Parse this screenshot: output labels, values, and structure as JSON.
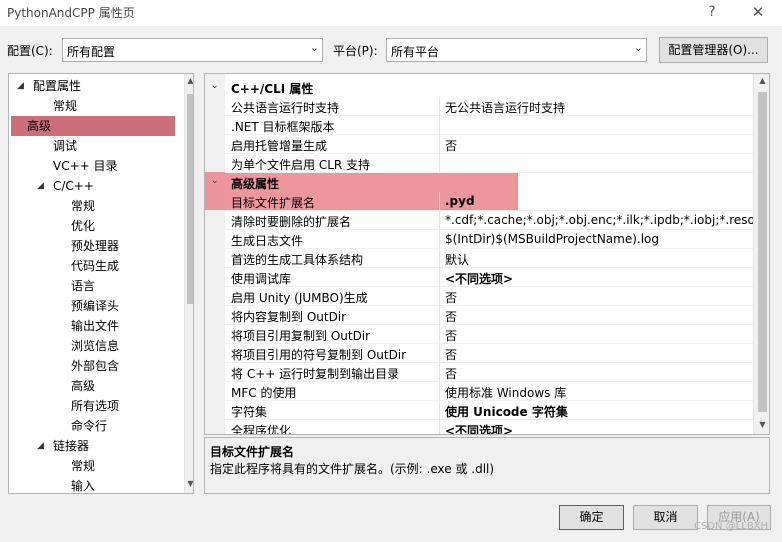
{
  "window": {
    "title": "PythonAndCPP 属性页",
    "help": "?",
    "close": "✕"
  },
  "config": {
    "label": "配置(C):",
    "value": "所有配置"
  },
  "platform": {
    "label": "平台(P):",
    "value": "所有平台"
  },
  "manager_button": "配置管理器(O)...",
  "tree": {
    "items": [
      {
        "label": "配置属性",
        "expander": "◢"
      },
      {
        "label": "常规"
      },
      {
        "label": "高级"
      },
      {
        "label": "调试"
      },
      {
        "label": "VC++ 目录"
      },
      {
        "label": "C/C++",
        "expander": "◢"
      },
      {
        "label": "常规"
      },
      {
        "label": "优化"
      },
      {
        "label": "预处理器"
      },
      {
        "label": "代码生成"
      },
      {
        "label": "语言"
      },
      {
        "label": "预编译头"
      },
      {
        "label": "输出文件"
      },
      {
        "label": "浏览信息"
      },
      {
        "label": "外部包含"
      },
      {
        "label": "高级"
      },
      {
        "label": "所有选项"
      },
      {
        "label": "命令行"
      },
      {
        "label": "链接器",
        "expander": "◢"
      },
      {
        "label": "常规"
      },
      {
        "label": "输入"
      }
    ],
    "selected_index": 2
  },
  "grid": {
    "rows": [
      {
        "name": "C++/CLI 属性",
        "expander": "⌄"
      },
      {
        "name": "公共语言运行时支持",
        "value": "无公共语言运行时支持"
      },
      {
        "name": ".NET 目标框架版本",
        "value": ""
      },
      {
        "name": "启用托管增量生成",
        "value": "否"
      },
      {
        "name": "为单个文件启用 CLR 支持",
        "value": ""
      },
      {
        "name": "高级属性",
        "expander": "⌄"
      },
      {
        "name": "目标文件扩展名",
        "value": ".pyd"
      },
      {
        "name": "清除时要删除的扩展名",
        "value": "*.cdf;*.cache;*.obj;*.obj.enc;*.ilk;*.ipdb;*.iobj;*.resources"
      },
      {
        "name": "生成日志文件",
        "value": "$(IntDir)$(MSBuildProjectName).log"
      },
      {
        "name": "首选的生成工具体系结构",
        "value": "默认"
      },
      {
        "name": "使用调试库",
        "value": "<不同选项>"
      },
      {
        "name": "启用 Unity (JUMBO)生成",
        "value": "否"
      },
      {
        "name": "将内容复制到 OutDir",
        "value": "否"
      },
      {
        "name": "将项目引用复制到 OutDir",
        "value": "否"
      },
      {
        "name": "将项目引用的符号复制到 OutDir",
        "value": "否"
      },
      {
        "name": "将 C++ 运行时复制到输出目录",
        "value": "否"
      },
      {
        "name": "MFC 的使用",
        "value": "使用标准 Windows 库"
      },
      {
        "name": "字符集",
        "value": "使用 Unicode 字符集"
      },
      {
        "name": "全程序优化",
        "value": "<不同选项>"
      }
    ]
  },
  "description": {
    "title": "目标文件扩展名",
    "text": "指定此程序将具有的文件扩展名。(示例: .exe 或 .dll)"
  },
  "buttons": {
    "ok": "确定",
    "cancel": "取消",
    "apply": "应用(A)"
  },
  "watermark": "CSDN @LLBXH",
  "colors": {
    "highlight": "#ec8d92",
    "selected_tree": "#cc6f7a"
  }
}
